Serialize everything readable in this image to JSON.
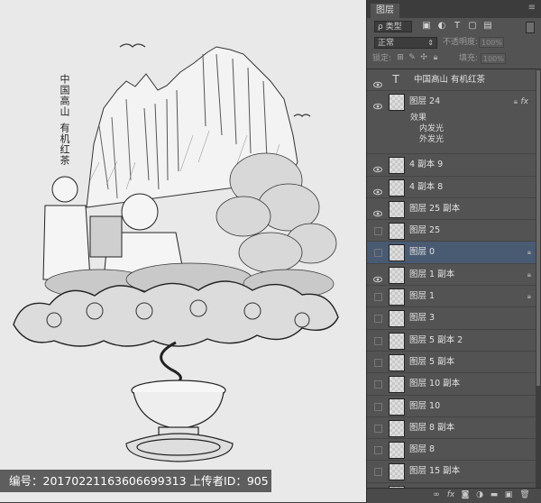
{
  "canvas": {
    "vertical_title_line1": "中国高山",
    "vertical_title_line2": "有机红茶",
    "watermark": "编号：20170221163606699313 上传者ID：905"
  },
  "panel": {
    "tab": "图层",
    "filter_kind": "ρ 类型",
    "blend_mode": "正常",
    "opacity_label": "不透明度:",
    "opacity_value": "100%",
    "lock_label": "锁定:",
    "fill_label": "填充:",
    "fill_value": "100%"
  },
  "layers": [
    {
      "name": "中国高山 有机红茶",
      "type": "text",
      "visible": true
    },
    {
      "name": "图层 24",
      "type": "effects",
      "visible": true,
      "fx": "fx",
      "effects": [
        "效果",
        "内发光",
        "外发光"
      ]
    },
    {
      "name": "4 副本 9",
      "visible": true
    },
    {
      "name": "4 副本 8",
      "visible": true
    },
    {
      "name": "图层 25 副本",
      "visible": true
    },
    {
      "name": "图层 25",
      "visible": false
    },
    {
      "name": "图层 0",
      "visible": false,
      "selected": true,
      "locked": true
    },
    {
      "name": "图层 1 副本",
      "visible": true,
      "locked": true
    },
    {
      "name": "图层 1",
      "visible": false,
      "locked": true
    },
    {
      "name": "图层 3",
      "visible": false
    },
    {
      "name": "图层 5 副本 2",
      "visible": false
    },
    {
      "name": "图层 5 副本",
      "visible": false
    },
    {
      "name": "图层 10 副本",
      "visible": false
    },
    {
      "name": "图层 10",
      "visible": false
    },
    {
      "name": "图层 8 副本",
      "visible": false
    },
    {
      "name": "图层 8",
      "visible": false
    },
    {
      "name": "图层 15 副本",
      "visible": false
    },
    {
      "name": "图层 15",
      "visible": false
    }
  ],
  "footer_icons": [
    "link-icon",
    "fx-icon",
    "mask-icon",
    "adjustment-icon",
    "folder-icon",
    "new-layer-icon",
    "trash-icon"
  ]
}
